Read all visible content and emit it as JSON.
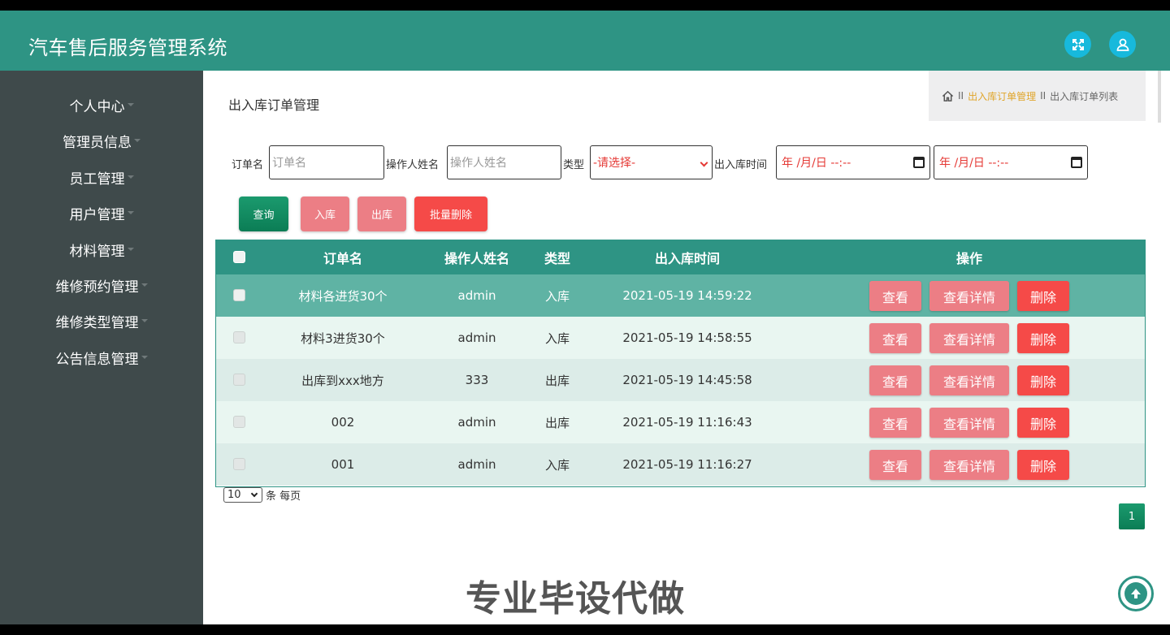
{
  "app": {
    "title": "汽车售后服务管理系统"
  },
  "header": {
    "icons": [
      "fullscreen-icon",
      "user-icon"
    ]
  },
  "sidebar": {
    "items": [
      {
        "label": "个人中心"
      },
      {
        "label": "管理员信息"
      },
      {
        "label": "员工管理"
      },
      {
        "label": "用户管理"
      },
      {
        "label": "材料管理"
      },
      {
        "label": "维修预约管理"
      },
      {
        "label": "维修类型管理"
      },
      {
        "label": "公告信息管理"
      }
    ]
  },
  "page": {
    "title": "出入库订单管理"
  },
  "breadcrumb": {
    "home_icon": "home-icon",
    "sep": "II",
    "active": "出入库订单管理",
    "current": "出入库订单列表"
  },
  "search": {
    "order_label": "订单名",
    "order_placeholder": "订单名",
    "operator_label": "操作人姓名",
    "operator_placeholder": "操作人姓名",
    "type_label": "类型",
    "type_value": "-请选择-",
    "time_label": "出入库时间",
    "date_from": "年 /月/日 --:--",
    "date_to": "年 /月/日 --:--"
  },
  "toolbar": {
    "query": "查询",
    "stock_in": "入库",
    "stock_out": "出库",
    "batch_delete": "批量删除"
  },
  "table": {
    "columns": [
      "订单名",
      "操作人姓名",
      "类型",
      "出入库时间",
      "操作"
    ],
    "rows": [
      {
        "name": "材料各进货30个",
        "operator": "admin",
        "type": "入库",
        "time": "2021-05-19 14:59:22"
      },
      {
        "name": "材料3进货30个",
        "operator": "admin",
        "type": "入库",
        "time": "2021-05-19 14:58:55"
      },
      {
        "name": "出库到xxx地方",
        "operator": "333",
        "type": "出库",
        "time": "2021-05-19 14:45:58"
      },
      {
        "name": "002",
        "operator": "admin",
        "type": "出库",
        "time": "2021-05-19 11:16:43"
      },
      {
        "name": "001",
        "operator": "admin",
        "type": "入库",
        "time": "2021-05-19 11:16:27"
      }
    ],
    "actions": {
      "view": "查看",
      "detail": "查看详情",
      "delete": "删除"
    }
  },
  "pagination": {
    "page_size": "10",
    "per_page_text": "条 每页",
    "current_page": "1"
  },
  "overlay": {
    "watermark": "专业毕设代做"
  },
  "colors": {
    "primary": "#2e9484",
    "sidebar": "#3f4a4b",
    "pink": "#ec7e85",
    "red": "#f54a48",
    "accent_blue": "#17b9dc"
  }
}
